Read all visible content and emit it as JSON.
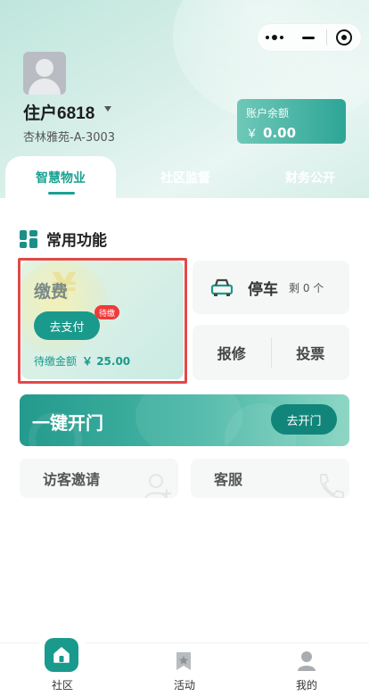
{
  "header": {
    "user_name": "住户6818",
    "address": "杏林雅苑-A-3003",
    "balance_label": "账户余额",
    "balance_currency": "￥",
    "balance_value": "0.00"
  },
  "tabs": [
    {
      "label": "智慧物业",
      "active": true
    },
    {
      "label": "社区监督",
      "active": false
    },
    {
      "label": "财务公开",
      "active": false
    }
  ],
  "section": {
    "title": "常用功能"
  },
  "payment": {
    "title": "缴费",
    "button": "去支付",
    "badge": "待缴",
    "amount_label": "待缴金额",
    "amount_value": "￥ 25.00"
  },
  "parking": {
    "label": "停车",
    "remaining": "剩 0 个"
  },
  "repair": {
    "label": "报修"
  },
  "vote": {
    "label": "投票"
  },
  "door": {
    "title": "一键开门",
    "button": "去开门"
  },
  "visitor": {
    "label": "访客邀请"
  },
  "service": {
    "label": "客服"
  },
  "tabbar": [
    {
      "label": "社区",
      "icon": "home-icon"
    },
    {
      "label": "活动",
      "icon": "flag-icon"
    },
    {
      "label": "我的",
      "icon": "person-icon"
    }
  ],
  "colors": {
    "accent": "#1a9a8c",
    "badge": "#ee3b3b",
    "highlight": "#e24848"
  }
}
